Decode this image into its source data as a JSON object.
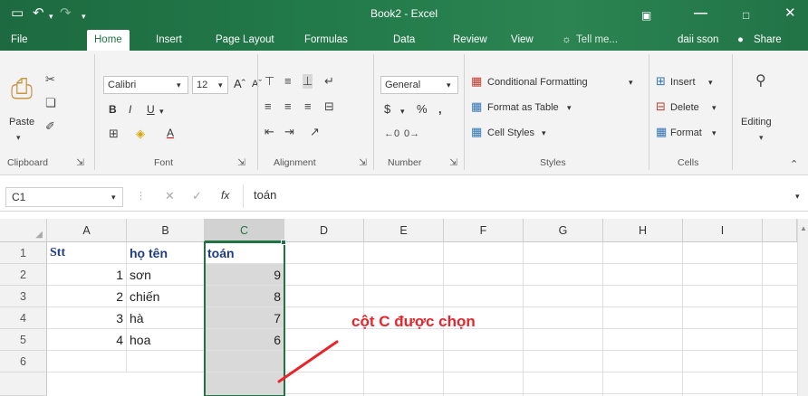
{
  "window": {
    "title": "Book2 - Excel",
    "account": "daii sson",
    "tell_me": "Tell me...",
    "share": "Share"
  },
  "tabs": [
    "File",
    "Home",
    "Insert",
    "Page Layout",
    "Formulas",
    "Data",
    "Review",
    "View"
  ],
  "active_tab": "Home",
  "ribbon": {
    "clipboard": {
      "label": "Clipboard",
      "paste": "Paste"
    },
    "font": {
      "label": "Font",
      "name": "Calibri",
      "size": "12",
      "bold": "B",
      "italic": "I",
      "underline": "U"
    },
    "alignment": {
      "label": "Alignment"
    },
    "number": {
      "label": "Number",
      "format": "General",
      "currency": "$",
      "percent": "%",
      "comma": ","
    },
    "styles": {
      "label": "Styles",
      "conditional": "Conditional Formatting",
      "table": "Format as Table",
      "cell_styles": "Cell Styles"
    },
    "cells": {
      "label": "Cells",
      "insert": "Insert",
      "delete": "Delete",
      "format": "Format"
    },
    "editing": {
      "label": "Editing"
    }
  },
  "formula_bar": {
    "name_box": "C1",
    "fx": "fx",
    "value": "toán"
  },
  "sheet": {
    "columns": [
      "A",
      "B",
      "C",
      "D",
      "E",
      "F",
      "G",
      "H",
      "I"
    ],
    "rows": [
      "1",
      "2",
      "3",
      "4",
      "5",
      "6"
    ],
    "cells": {
      "A1": "Stt",
      "B1": "họ tên",
      "C1": "toán",
      "A2": "1",
      "B2": "sơn",
      "C2": "9",
      "A3": "2",
      "B3": "chiến",
      "C3": "8",
      "A4": "3",
      "B4": "hà",
      "C4": "7",
      "A5": "4",
      "B5": "hoa",
      "C5": "6"
    },
    "selected_column": "C"
  },
  "annotation": "cột C được chọn",
  "colors": {
    "accent": "#217346",
    "annotation": "#e8252b"
  }
}
